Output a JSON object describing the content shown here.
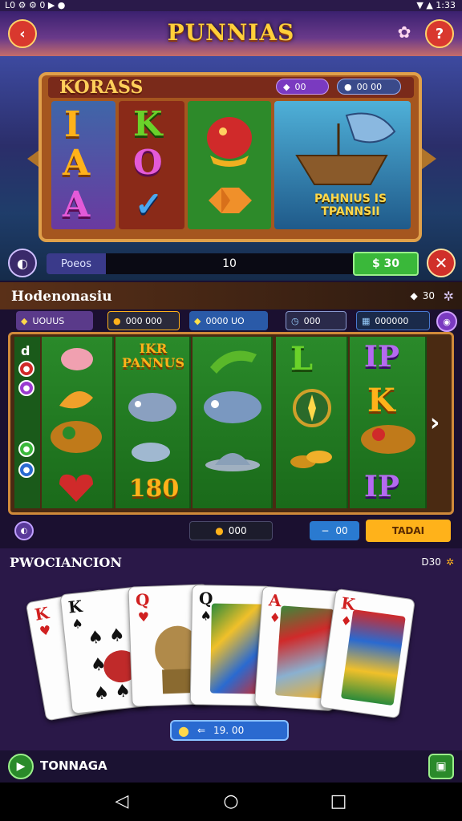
{
  "status_bar": {
    "left": "L0 ⚙ ⚙ 0 ▶ ●",
    "right": "▼ ▲ 1:33"
  },
  "header": {
    "title": "PUNNIAS",
    "back_icon": "back-arrow-icon",
    "help_icon": "help-icon",
    "gift_icon": "gift-icon"
  },
  "slot1": {
    "name": "KORASS",
    "pill_left": "00",
    "pill_right": "00 00",
    "reel1": [
      "I",
      "A",
      "A"
    ],
    "reel2": [
      "K",
      "O",
      "✓"
    ],
    "boat_label": "PAHNIUS IS\nTPANNSII",
    "field_label": "Poeos",
    "field_value": "10",
    "spin_value": "$ 30"
  },
  "slot2": {
    "title": "Hodenonasiu",
    "right_value": "30",
    "pills": [
      "UOUUS",
      "000 000",
      "0000 UO",
      "000",
      "000000"
    ],
    "reel2_header": "IKR\nPANNUS",
    "big_num": "180",
    "reel5_syms": [
      "L",
      "IP",
      "K",
      "IP"
    ],
    "bet_value": "000",
    "minus_label": "00",
    "spin2_label": "TADAI"
  },
  "cards_section": {
    "title": "PWOCIANCION",
    "right_value": "D30",
    "cards": [
      {
        "rank": "K",
        "suit": "♥"
      },
      {
        "rank": "K",
        "suit": "♠"
      },
      {
        "rank": "Q",
        "suit": "♥"
      },
      {
        "rank": "Q",
        "suit": "♠"
      },
      {
        "rank": "A",
        "suit": "♦"
      },
      {
        "rank": "K",
        "suit": "♦"
      }
    ],
    "coin_value": "19. 00"
  },
  "bottom": {
    "label": "TONNAGA"
  },
  "colors": {
    "accent_gold": "#ffb21a",
    "accent_red": "#d9382e",
    "accent_green": "#3ab83a"
  }
}
